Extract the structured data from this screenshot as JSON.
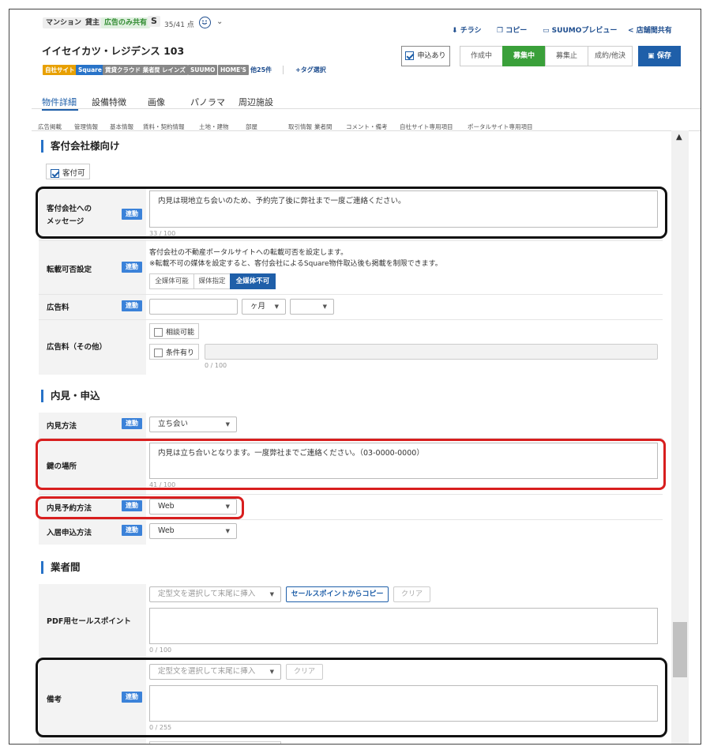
{
  "header": {
    "type_badge": "マンション",
    "owner_badge": "貸主",
    "ad_badge": "広告のみ共有",
    "rank": "S",
    "score": "35/41 点",
    "smile_icon": "smile-icon",
    "title": "イイセイカツ・レジデンス 103",
    "actions": [
      "チラシ",
      "コピー",
      "SUUMOプレビュー",
      "店舗間共有"
    ],
    "apply_checkbox_label": "申込あり",
    "status_buttons": [
      "作成中",
      "募集中",
      "募集止",
      "成約/他決"
    ],
    "active_status": "募集中",
    "save_label": "保存"
  },
  "tags": [
    {
      "label": "自社サイト",
      "color": "#e8a000"
    },
    {
      "label": "Square",
      "color": "#2873c8"
    },
    {
      "label": "賃貸クラウド 業者間",
      "color": "#888888"
    },
    {
      "label": "レインズ",
      "color": "#888888"
    },
    {
      "label": "SUUMO",
      "color": "#888888"
    },
    {
      "label": "HOME'S",
      "color": "#888888"
    }
  ],
  "tags_more": "他25件",
  "tag_select": "+タグ選択",
  "tabs": [
    "物件詳細",
    "設備特徴",
    "画像",
    "パノラマ",
    "周辺施設"
  ],
  "active_tab": "物件詳細",
  "sub_nav": [
    "広告掲載",
    "管理情報",
    "基本情報",
    "賃料・契約情報",
    "土地・建物",
    "部屋",
    "取引情報",
    "業者間",
    "コメント・備考",
    "自社サイト専用項目",
    "ポータルサイト専用項目"
  ],
  "section1": {
    "title": "客付会社様向け",
    "checkbox": "客付可",
    "message_label": "客付会社への\nメッセージ",
    "link_badge": "連動",
    "message_value": "内見は現地立ち会いのため、予約完了後に弊社まで一度ご連絡ください。",
    "message_count": "33 / 100",
    "repost_label": "転載可否設定",
    "repost_desc1": "客付会社の不動産ポータルサイトへの転載可否を設定します。",
    "repost_desc2": "※転載不可の媒体を設定すると、客付会社によるSquare物件取込後も掲載を制限できます。",
    "repost_options": [
      "全媒体可能",
      "媒体指定",
      "全媒体不可"
    ],
    "repost_active": "全媒体不可",
    "adfee_label": "広告料",
    "adfee_unit": "ヶ月",
    "adfee_other_label": "広告料（その他）",
    "negotiable": "相談可能",
    "conditional": "条件有り",
    "adfee_other_count": "0 / 100"
  },
  "section2": {
    "title": "内見・申込",
    "view_method_label": "内見方法",
    "view_method_value": "立ち会い",
    "key_label": "鍵の場所",
    "key_value": "内見は立ち合いとなります。一度弊社までご連絡ください。（03-0000-0000）",
    "key_count": "41 / 100",
    "reserve_label": "内見予約方法",
    "reserve_value": "Web",
    "apply_label": "入居申込方法",
    "apply_value": "Web"
  },
  "section3": {
    "title": "業者間",
    "template_placeholder": "定型文を選択して末尾に挿入",
    "copy_sales": "セールスポイントからコピー",
    "clear": "クリア",
    "pdf_label": "PDF用セールスポイント",
    "pdf_count": "0 / 100",
    "note_label": "備考",
    "note_count": "0 / 255"
  },
  "colors": {
    "accent_blue": "#1f5fa9",
    "active_green": "#3aa03a",
    "link_badge": "#3b82d9",
    "highlight_red": "#d81e1e"
  }
}
